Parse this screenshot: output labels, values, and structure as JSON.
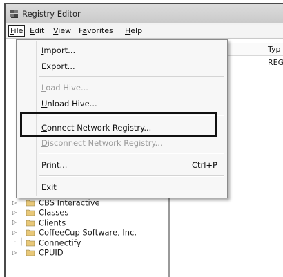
{
  "window": {
    "title": "Registry Editor",
    "icon": "registry-editor-icon"
  },
  "menubar": {
    "items": [
      {
        "id": "file",
        "acc": "F",
        "rest": "ile"
      },
      {
        "id": "edit",
        "acc": "E",
        "rest": "dit"
      },
      {
        "id": "view",
        "acc": "V",
        "rest": "iew"
      },
      {
        "id": "favorites",
        "pre": "F",
        "acc": "a",
        "rest": "vorites"
      },
      {
        "id": "help",
        "acc": "H",
        "rest": "elp"
      }
    ]
  },
  "file_menu": {
    "import": {
      "acc": "I",
      "rest": "mport..."
    },
    "export": {
      "acc": "E",
      "rest": "xport..."
    },
    "load_hive": {
      "acc": "L",
      "rest": "oad Hive...",
      "disabled": true
    },
    "unload_hive": {
      "acc": "U",
      "rest": "nload Hive..."
    },
    "connect": {
      "acc": "C",
      "rest": "onnect Network Registry..."
    },
    "disconnect": {
      "acc": "D",
      "rest": "isconnect Network Registry...",
      "disabled": true
    },
    "print": {
      "acc": "P",
      "rest": "rint...",
      "shortcut": "Ctrl+P"
    },
    "exit": {
      "pre": "E",
      "acc": "x",
      "rest": "it"
    }
  },
  "values_pane": {
    "column_type": "Typ",
    "row_fragment": ")",
    "row_type": "REG"
  },
  "tree": {
    "items": [
      {
        "label": "CBS Interactive",
        "expandable": true
      },
      {
        "label": "Classes",
        "expandable": true
      },
      {
        "label": "Clients",
        "expandable": true
      },
      {
        "label": "CoffeeCup Software, Inc.",
        "expandable": true
      },
      {
        "label": "Connectify",
        "expandable": false
      },
      {
        "label": "CPUID",
        "expandable": true
      }
    ]
  },
  "colors": {
    "folder": "#e8c878",
    "highlight_border": "#111111",
    "disabled_text": "#9a9a9a"
  }
}
